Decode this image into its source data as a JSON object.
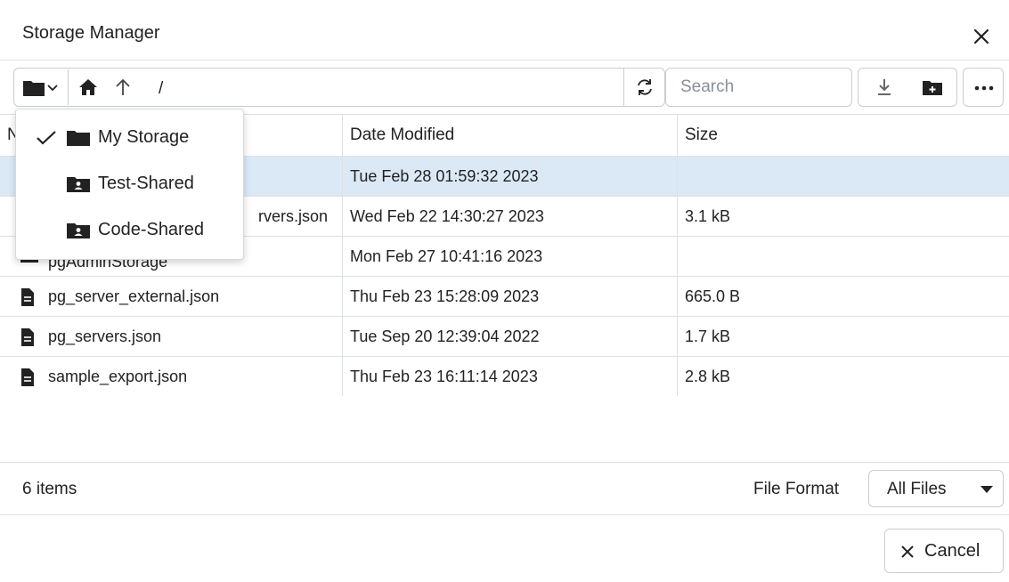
{
  "window": {
    "title": "Storage Manager",
    "close_icon": "close-icon"
  },
  "toolbar": {
    "storage_icon": "folder-icon",
    "storage_caret_icon": "chevron-down-icon",
    "home_icon": "home-icon",
    "up_icon": "arrow-up-icon",
    "path": "/",
    "refresh_icon": "refresh-icon",
    "search_placeholder": "Search",
    "search_value": "",
    "download_icon": "download-icon",
    "new_folder_icon": "new-folder-icon",
    "more_icon": "more-icon"
  },
  "storage_menu": {
    "items": [
      {
        "label": "My Storage",
        "icon": "folder-icon",
        "checked": true
      },
      {
        "label": "Test-Shared",
        "icon": "shared-folder-icon",
        "checked": false
      },
      {
        "label": "Code-Shared",
        "icon": "shared-folder-icon",
        "checked": false
      }
    ]
  },
  "table": {
    "columns": [
      "Name",
      "Date Modified",
      "Size"
    ],
    "rows": [
      {
        "name": "",
        "date": "Tue Feb 28 01:59:32 2023",
        "size": "",
        "type": "folder",
        "selected": true
      },
      {
        "name": "rvers.json",
        "date": "Wed Feb 22 14:30:27 2023",
        "size": "3.1 kB",
        "type": "file",
        "selected": false
      },
      {
        "name": "pgAdminStorage",
        "date": "Mon Feb 27 10:41:16 2023",
        "size": "",
        "type": "folder",
        "selected": false
      },
      {
        "name": "pg_server_external.json",
        "date": "Thu Feb 23 15:28:09 2023",
        "size": "665.0 B",
        "type": "file",
        "selected": false
      },
      {
        "name": "pg_servers.json",
        "date": "Tue Sep 20 12:39:04 2022",
        "size": "1.7 kB",
        "type": "file",
        "selected": false
      },
      {
        "name": "sample_export.json",
        "date": "Thu Feb 23 16:11:14 2023",
        "size": "2.8 kB",
        "type": "file",
        "selected": false
      }
    ]
  },
  "footer": {
    "item_count": "6 items",
    "format_label": "File Format",
    "format_value": "All Files",
    "cancel_label": "Cancel"
  },
  "colors": {
    "selected_row": "#dbe9f7",
    "border": "#dde0e6",
    "text": "#222222"
  }
}
